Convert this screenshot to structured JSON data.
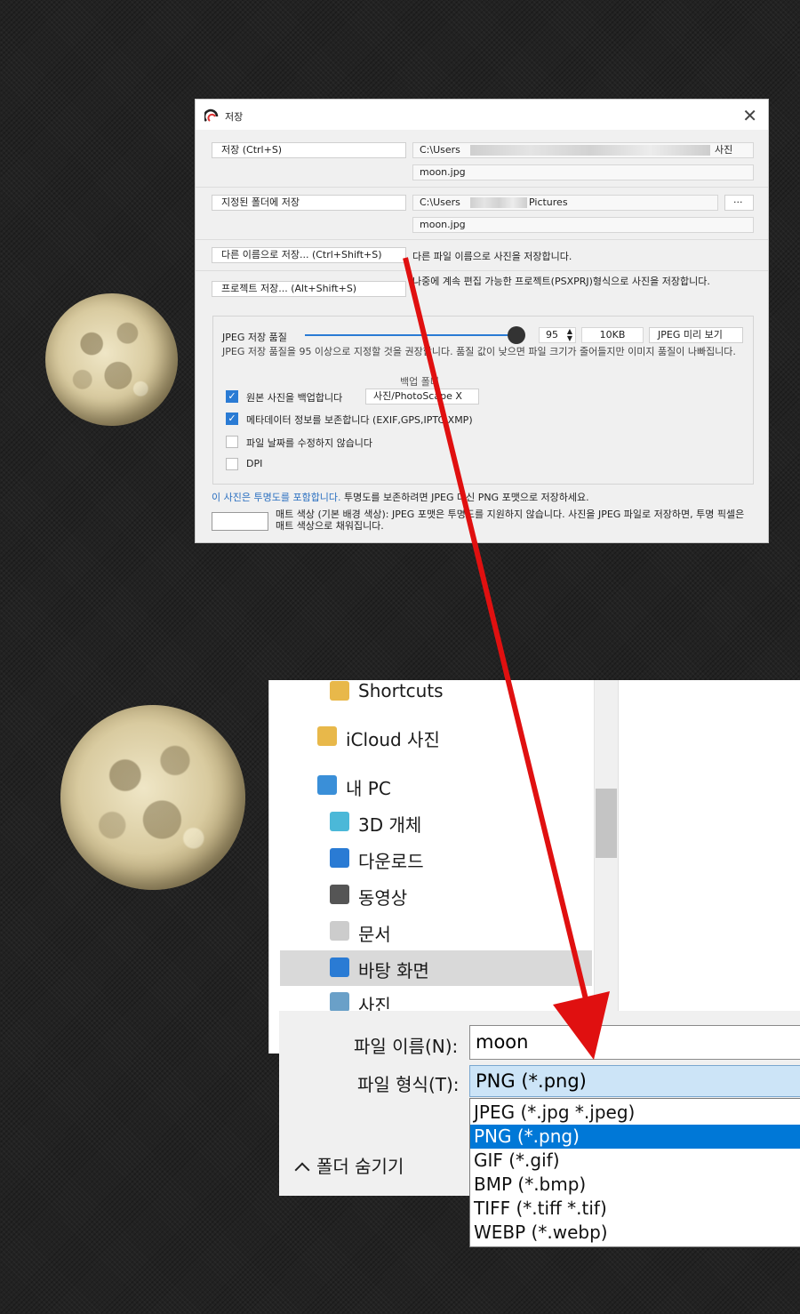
{
  "dialog": {
    "title": "저장",
    "save_button": "저장   (Ctrl+S)",
    "save_path_prefix": "C:\\Users",
    "save_path_suffix": "사진",
    "save_filename": "moon.jpg",
    "folder_button": "지정된 폴더에 저장",
    "folder_path_prefix": "C:\\Users",
    "folder_path_suffix": "Pictures",
    "browse_button": "···",
    "folder_filename": "moon.jpg",
    "saveas_button": "다른 이름으로 저장...   (Ctrl+Shift+S)",
    "saveas_desc": "다른 파일 이름으로 사진을 저장합니다.",
    "project_button": "프로젝트 저장...   (Alt+Shift+S)",
    "project_desc": "나중에 계속 편집 가능한 프로젝트(PSXPRJ)형식으로 사진을 저장합니다.",
    "jpeg_quality_label": "JPEG 저장 품질",
    "quality_value": "95",
    "quality_fraction": 0.95,
    "file_size": "10KB",
    "preview_button": "JPEG 미리 보기",
    "quality_hint": "JPEG 저장 품질을 95 이상으로 지정할 것을 권장합니다. 품질 값이 낮으면 파일 크기가 줄어들지만 이미지 품질이 나빠집니다.",
    "backup_folder_label": "백업 폴더",
    "backup_checkbox": "원본 사진을 백업합니다",
    "backup_folder_value": "사진/PhotoScape X",
    "metadata_checkbox": "메타데이터 정보를 보존합니다 (EXIF,GPS,IPTC,XMP)",
    "date_checkbox": "파일 날짜를 수정하지 않습니다",
    "dpi_checkbox": "DPI",
    "transparency_link": "이 사진은 투명도를 포함합니다.",
    "transparency_text": " 투명도를 보존하려면 JPEG 대신 PNG 포맷으로 저장하세요.",
    "matte_text": "매트 색상 (기본 배경 색상): JPEG 포맷은 투명도를 지원하지 않습니다. 사진을 JPEG 파일로 저장하면, 투명 픽셀은 매트 색상으로 채워집니다."
  },
  "explorer": {
    "tree": [
      {
        "label": "Shortcuts",
        "icon": "shortcut-folder-icon"
      },
      {
        "label": "iCloud 사진",
        "icon": "folder-icon"
      },
      {
        "label": "내 PC",
        "icon": "pc-icon"
      },
      {
        "label": "3D 개체",
        "icon": "3d-objects-icon"
      },
      {
        "label": "다운로드",
        "icon": "download-icon"
      },
      {
        "label": "동영상",
        "icon": "video-icon"
      },
      {
        "label": "문서",
        "icon": "document-icon"
      },
      {
        "label": "바탕 화면",
        "icon": "desktop-icon"
      },
      {
        "label": "사진",
        "icon": "pictures-icon"
      }
    ],
    "filename_label": "파일 이름(N):",
    "filename_value": "moon",
    "filetype_label": "파일 형식(T):",
    "filetype_value": "PNG (*.png)",
    "options": [
      "JPEG (*.jpg *.jpeg)",
      "PNG (*.png)",
      "GIF (*.gif)",
      "BMP (*.bmp)",
      "TIFF (*.tiff *.tif)",
      "WEBP (*.webp)"
    ],
    "selected_option": 1,
    "hide_folders": "폴더 숨기기"
  },
  "colors": {
    "accent": "#2a7bd4",
    "selection": "#0078d7",
    "arrow": "#e01010"
  }
}
